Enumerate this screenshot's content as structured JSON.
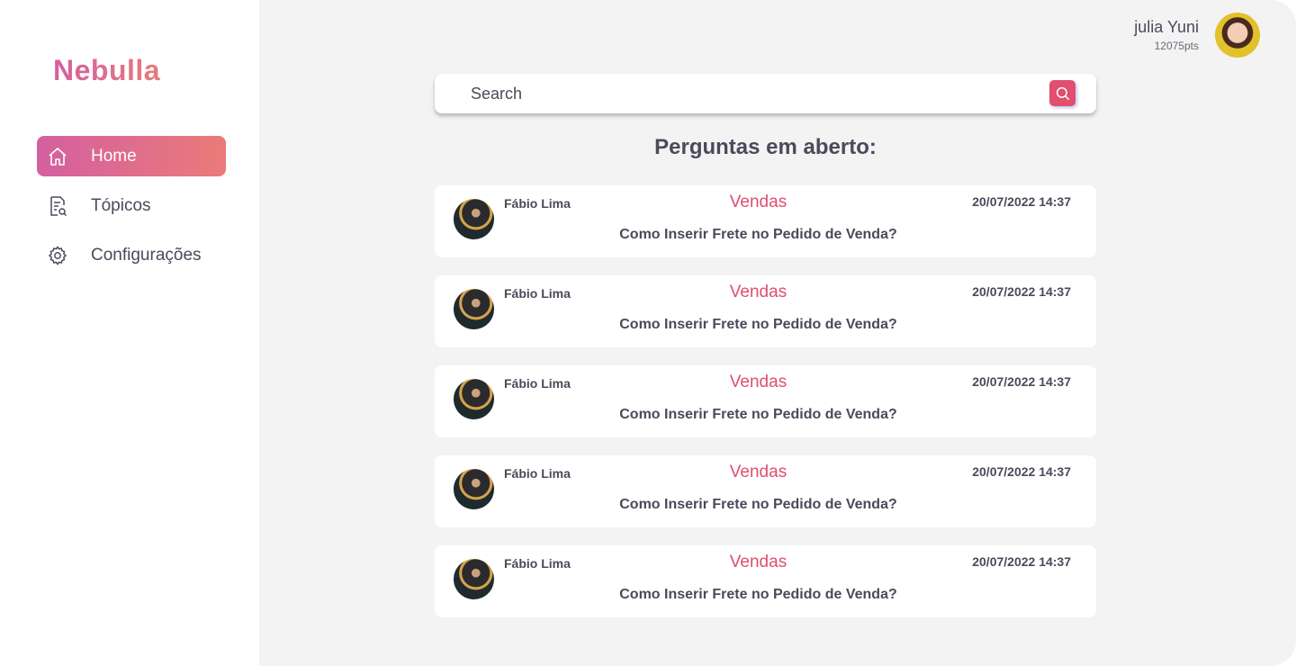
{
  "brand": {
    "name": "Nebulla"
  },
  "sidebar": {
    "items": [
      {
        "label": "Home",
        "icon": "home-icon",
        "active": true
      },
      {
        "label": "Tópicos",
        "icon": "document-search-icon",
        "active": false
      },
      {
        "label": "Configurações",
        "icon": "gear-icon",
        "active": false
      }
    ]
  },
  "user": {
    "name": "julia Yuni",
    "points": "12075pts"
  },
  "search": {
    "placeholder": "Search"
  },
  "main": {
    "section_title": "Perguntas em aberto:"
  },
  "questions": [
    {
      "author": "Fábio Lima",
      "topic": "Vendas",
      "date": "20/07/2022 14:37",
      "question": "Como Inserir Frete no Pedido de Venda?"
    },
    {
      "author": "Fábio Lima",
      "topic": "Vendas",
      "date": "20/07/2022 14:37",
      "question": "Como Inserir Frete no Pedido de Venda?"
    },
    {
      "author": "Fábio Lima",
      "topic": "Vendas",
      "date": "20/07/2022 14:37",
      "question": "Como Inserir Frete no Pedido de Venda?"
    },
    {
      "author": "Fábio Lima",
      "topic": "Vendas",
      "date": "20/07/2022 14:37",
      "question": "Como Inserir Frete no Pedido de Venda?"
    },
    {
      "author": "Fábio Lima",
      "topic": "Vendas",
      "date": "20/07/2022 14:37",
      "question": "Como Inserir Frete no Pedido de Venda?"
    }
  ],
  "colors": {
    "accent": "#e14e6e",
    "gradient_start": "#d45fa0",
    "gradient_end": "#ea7b78",
    "background": "#f3f3f4"
  }
}
